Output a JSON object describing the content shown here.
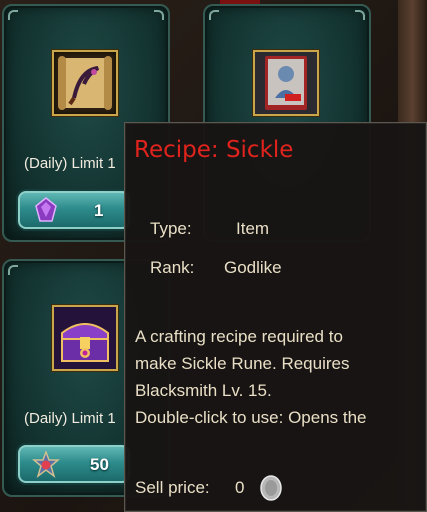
{
  "shop": {
    "items": [
      {
        "name": "recipe-scroll",
        "limit_label": "(Daily) Limit 1",
        "price": "1",
        "currency_icon": "purple-gem-icon"
      },
      {
        "name": "book-card",
        "limit_label": "",
        "price": "",
        "currency_icon": ""
      },
      {
        "name": "treasure-chest",
        "limit_label": "(Daily) Limit 1",
        "price": "50",
        "currency_icon": "medal-icon"
      }
    ]
  },
  "tooltip": {
    "title": "Recipe: Sickle",
    "type_label": "Type:",
    "type_value": "Item",
    "rank_label": "Rank:",
    "rank_value": "Godlike",
    "description": [
      "A crafting recipe required to",
      "make Sickle Rune. Requires",
      "Blacksmith Lv. 15.",
      "Double-click to use: Opens the"
    ],
    "sell_label": "Sell price:",
    "sell_value": "0",
    "sell_currency_icon": "silver-coin-icon"
  },
  "colors": {
    "title_red": "#e1231d",
    "text_cream": "#e9dfc6",
    "card_teal": "#143532",
    "frame_gold": "#c9a64a"
  }
}
